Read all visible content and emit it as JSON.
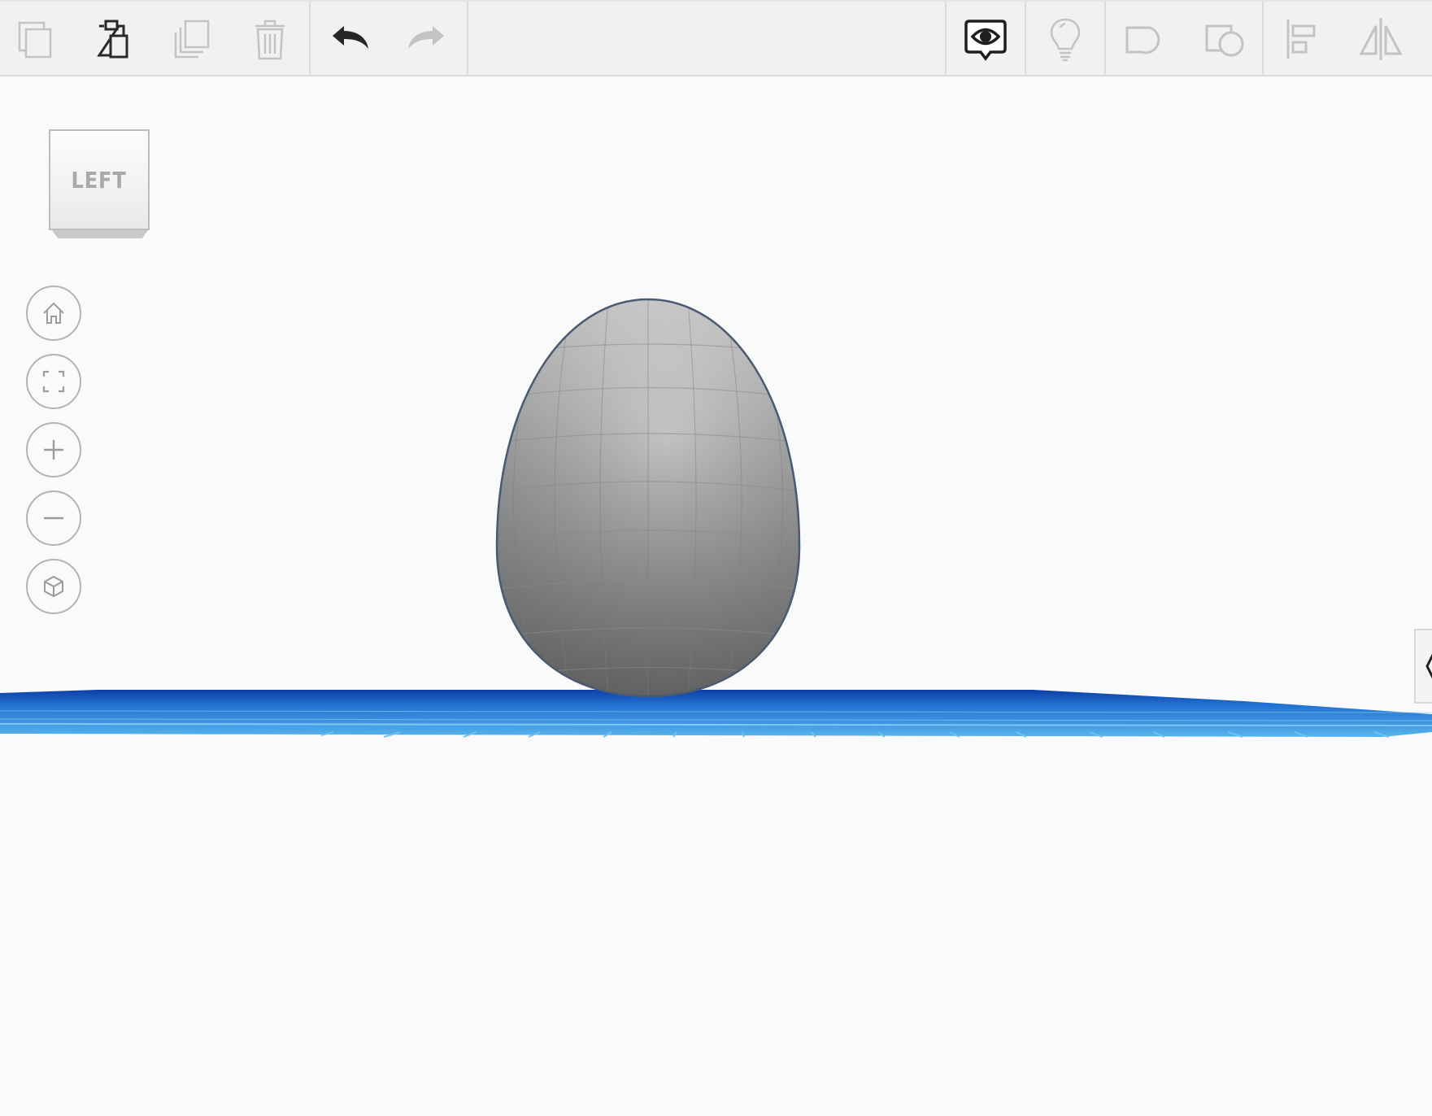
{
  "toolbar": {
    "left_group": [
      {
        "id": "copy",
        "icon": "copy-icon",
        "enabled": false
      },
      {
        "id": "paste",
        "icon": "paste-icon",
        "enabled": true
      },
      {
        "id": "duplicate",
        "icon": "duplicate-icon",
        "enabled": false
      },
      {
        "id": "delete",
        "icon": "trash-icon",
        "enabled": false
      }
    ],
    "history_group": [
      {
        "id": "undo",
        "icon": "undo-icon",
        "enabled": true
      },
      {
        "id": "redo",
        "icon": "redo-icon",
        "enabled": false
      }
    ],
    "right_group": [
      {
        "id": "notes",
        "icon": "eye-comment-icon",
        "enabled": true
      },
      {
        "id": "light",
        "icon": "lightbulb-icon",
        "enabled": false
      },
      {
        "id": "group",
        "icon": "group-shapes-icon",
        "enabled": false
      },
      {
        "id": "ungroup",
        "icon": "ungroup-shapes-icon",
        "enabled": false
      },
      {
        "id": "align",
        "icon": "align-icon",
        "enabled": false
      },
      {
        "id": "mirror",
        "icon": "mirror-icon",
        "enabled": false
      }
    ]
  },
  "view_cube": {
    "label": "LEFT"
  },
  "nav_controls": [
    {
      "id": "home",
      "icon": "home-icon"
    },
    {
      "id": "fit",
      "icon": "fit-view-icon"
    },
    {
      "id": "zoom_in",
      "icon": "zoom-in-icon"
    },
    {
      "id": "zoom_out",
      "icon": "zoom-out-icon"
    },
    {
      "id": "projection",
      "icon": "perspective-cube-icon"
    }
  ],
  "scene": {
    "object": {
      "shape": "egg",
      "color": "#9a9a9a",
      "outline": "#4a5a70"
    },
    "workplane": {
      "color": "#1a5fc4",
      "grid_color": "#6fc2f0"
    }
  },
  "edge_tab": {
    "icon": "chevron-left-icon"
  },
  "colors": {
    "active_icon": "#262626",
    "disabled_icon": "#bfbfbf",
    "background": "#fafafa",
    "toolbar": "#f1f1f2"
  }
}
